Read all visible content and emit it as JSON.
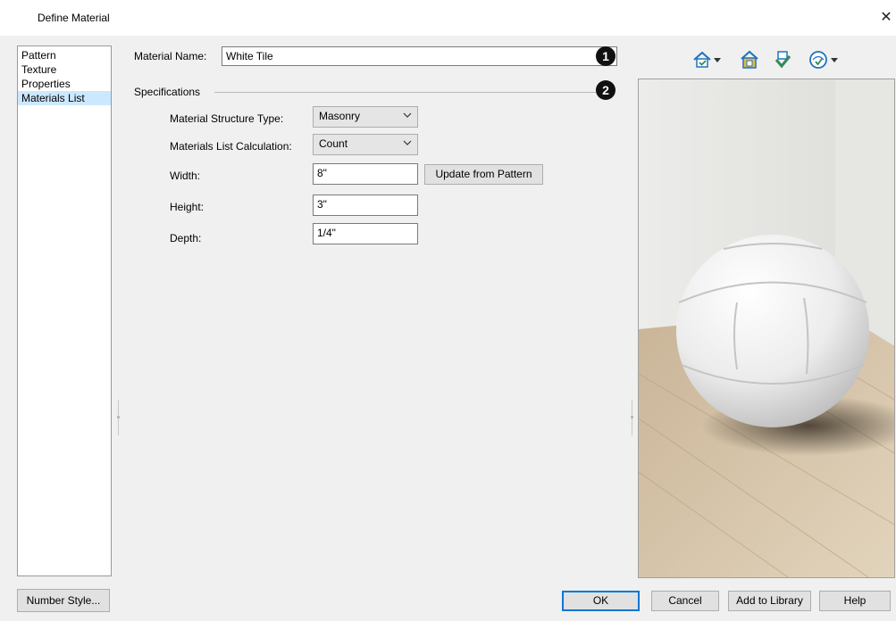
{
  "window": {
    "title": "Define Material",
    "close_glyph": "✕"
  },
  "nav": {
    "items": [
      {
        "label": "Pattern",
        "selected": false
      },
      {
        "label": "Texture",
        "selected": false
      },
      {
        "label": "Properties",
        "selected": false
      },
      {
        "label": "Materials List",
        "selected": true
      }
    ]
  },
  "material_name": {
    "label": "Material Name:",
    "value": "White Tile"
  },
  "callouts": [
    "1",
    "2"
  ],
  "specifications": {
    "title": "Specifications",
    "structure_type": {
      "label": "Material Structure Type:",
      "value": "Masonry"
    },
    "calculation": {
      "label": "Materials List Calculation:",
      "value": "Count"
    },
    "width": {
      "label": "Width:",
      "value": "8\""
    },
    "height": {
      "label": "Height:",
      "value": "3\""
    },
    "depth": {
      "label": "Depth:",
      "value": "1/4\""
    },
    "update_button": "Update from Pattern"
  },
  "toolbar": {
    "icons": [
      "home-view-icon",
      "house-walls-icon",
      "shield-check-icon",
      "lighting-globe-icon"
    ]
  },
  "buttons": {
    "number_style": "Number Style...",
    "ok": "OK",
    "cancel": "Cancel",
    "add_to_library": "Add to Library",
    "help": "Help"
  },
  "colors": {
    "accent": "#0078d7",
    "selection": "#cce8ff",
    "callout": "#111111",
    "icon_blue": "#1e73be",
    "icon_green": "#2e8b57"
  }
}
